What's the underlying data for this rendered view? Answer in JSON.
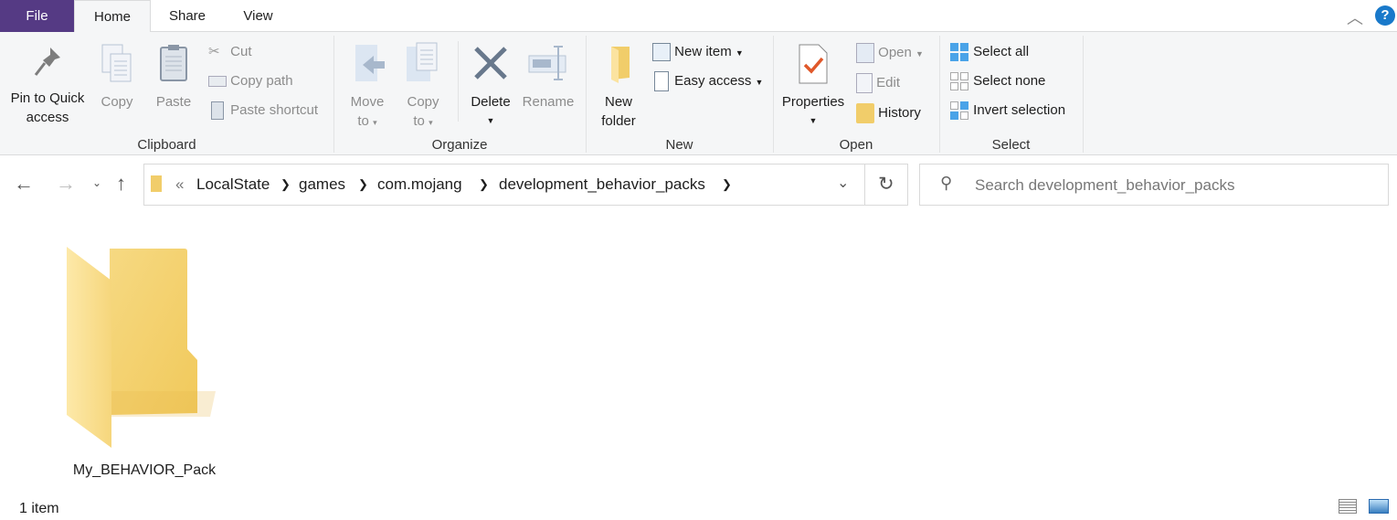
{
  "tabs": {
    "file": "File",
    "home": "Home",
    "share": "Share",
    "view": "View"
  },
  "ribbon": {
    "clipboard": {
      "label": "Clipboard",
      "pin_line1": "Pin to Quick",
      "pin_line2": "access",
      "copy": "Copy",
      "paste": "Paste",
      "cut": "Cut",
      "copy_path": "Copy path",
      "paste_shortcut": "Paste shortcut"
    },
    "organize": {
      "label": "Organize",
      "move_line1": "Move",
      "move_line2": "to",
      "copy_line1": "Copy",
      "copy_line2": "to",
      "delete": "Delete",
      "rename": "Rename"
    },
    "new": {
      "label": "New",
      "new_folder_line1": "New",
      "new_folder_line2": "folder",
      "new_item": "New item",
      "easy_access": "Easy access"
    },
    "open": {
      "label": "Open",
      "properties": "Properties",
      "open": "Open",
      "edit": "Edit",
      "history": "History"
    },
    "select": {
      "label": "Select",
      "select_all": "Select all",
      "select_none": "Select none",
      "invert_selection": "Invert selection"
    }
  },
  "address": {
    "overflow": "«",
    "crumbs": [
      "LocalState",
      "games",
      "com.mojang",
      "development_behavior_packs"
    ]
  },
  "search": {
    "placeholder": "Search development_behavior_packs"
  },
  "items": [
    {
      "name": "My_BEHAVIOR_Pack",
      "type": "folder"
    }
  ],
  "status": {
    "count": "1 item"
  },
  "colors": {
    "file_tab": "#553a84",
    "folder": "#f8d775",
    "help": "#1979ca"
  }
}
